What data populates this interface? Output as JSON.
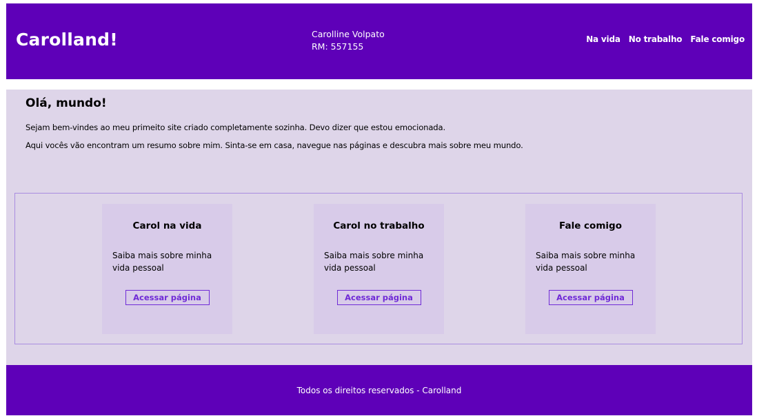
{
  "header": {
    "brand": "Carolland!",
    "student_name": "Carolline Volpato",
    "student_rm": "RM: 557155",
    "nav": [
      "Na vida",
      "No trabalho",
      "Fale comigo"
    ]
  },
  "intro": {
    "title": "Olá, mundo!",
    "paragraph_1": "Sejam bem-vindes ao meu primeito site criado completamente sozinha. Devo dizer que estou emocionada.",
    "paragraph_2": "Aqui vocês vão encontram um resumo sobre mim. Sinta-se em casa, navegue nas páginas e descubra mais sobre meu mundo."
  },
  "cards": [
    {
      "title": "Carol na vida",
      "text": "Saiba mais sobre minha vida pessoal",
      "button": "Acessar página"
    },
    {
      "title": "Carol no trabalho",
      "text": "Saiba mais sobre minha vida pessoal",
      "button": "Acessar página"
    },
    {
      "title": "Fale comigo",
      "text": "Saiba mais sobre minha vida pessoal",
      "button": "Acessar página"
    }
  ],
  "footer": {
    "text": "Todos os direitos reservados - Carolland"
  },
  "colors": {
    "brand_purple": "#5e00b8",
    "content_bg": "#ded5e9",
    "card_bg": "#d8cbe9",
    "accent": "#6f2ad6"
  }
}
